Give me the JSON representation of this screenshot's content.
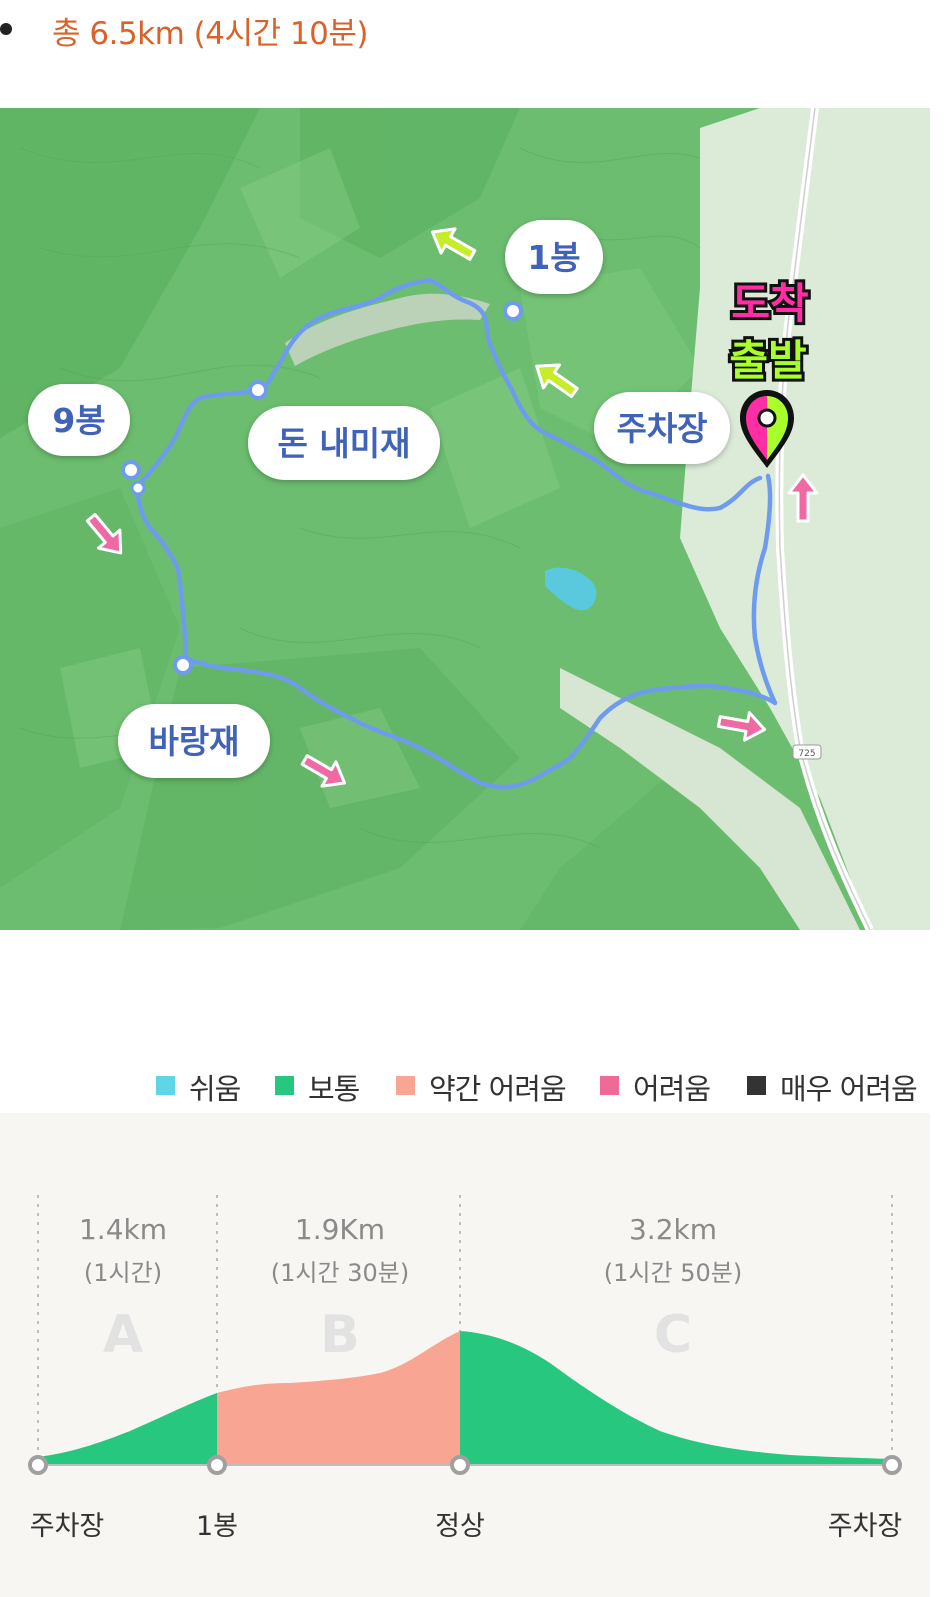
{
  "summary": {
    "text": "총 6.5km (4시간 10분)"
  },
  "map": {
    "labels": {
      "peak1": "1봉",
      "peak9": "9봉",
      "donnaemijae": "돈 내미재",
      "parking": "주차장",
      "baramjae": "바랑재",
      "arrival": "도착",
      "departure": "출발",
      "road_number": "725"
    },
    "colors": {
      "terrain": "#6cbd6f",
      "route": "#6f9bee",
      "arrow_yellow": "#c6ec2a",
      "arrow_pink": "#ef6aa2",
      "marker_pink": "#ff2ea5",
      "marker_green": "#a9ff2c"
    }
  },
  "legend": {
    "items": [
      {
        "label": "쉬움",
        "color": "#5fd5e6"
      },
      {
        "label": "보통",
        "color": "#27c780"
      },
      {
        "label": "약간 어려움",
        "color": "#f9a594"
      },
      {
        "label": "어려움",
        "color": "#ef6a95"
      },
      {
        "label": "매우 어려움",
        "color": "#333333"
      }
    ]
  },
  "profile": {
    "segments": [
      {
        "letter": "A",
        "distance": "1.4km",
        "time": "(1시간)",
        "difficulty": "보통"
      },
      {
        "letter": "B",
        "distance": "1.9Km",
        "time": "(1시간 30분)",
        "difficulty": "약간 어려움"
      },
      {
        "letter": "C",
        "distance": "3.2km",
        "time": "(1시간 50분)",
        "difficulty": "보통"
      }
    ],
    "points": [
      "주차장",
      "1봉",
      "정상",
      "주차장"
    ]
  }
}
